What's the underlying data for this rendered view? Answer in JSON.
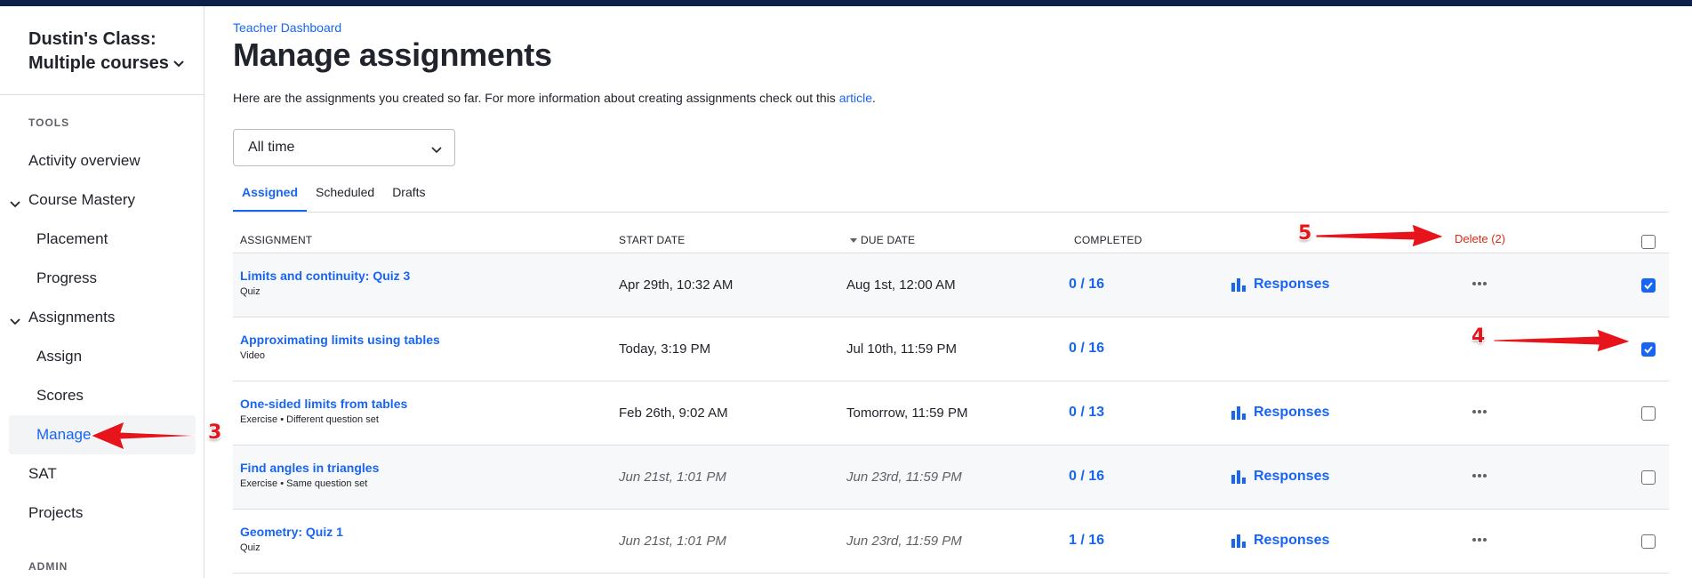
{
  "colors": {
    "accent": "#1865f2",
    "danger": "#d92916",
    "annotation": "#e8141b",
    "topbar": "#0b2149"
  },
  "sidebar": {
    "class_name": "Dustin's Class: Multiple courses",
    "class_line1": "Dustin's Class:",
    "class_line2": "Multiple courses",
    "tools_label": "TOOLS",
    "admin_label": "ADMIN",
    "items": [
      {
        "label": "Activity overview"
      },
      {
        "label": "Course Mastery",
        "expanded": true
      },
      {
        "label": "Placement"
      },
      {
        "label": "Progress"
      },
      {
        "label": "Assignments",
        "expanded": true
      },
      {
        "label": "Assign"
      },
      {
        "label": "Scores"
      },
      {
        "label": "Manage",
        "active": true
      },
      {
        "label": "SAT"
      },
      {
        "label": "Projects"
      }
    ]
  },
  "header": {
    "breadcrumb": "Teacher Dashboard",
    "title": "Manage assignments",
    "intro_text": "Here are the assignments you created so far. For more information about creating assignments check out this",
    "intro_link": "article",
    "intro_end": "."
  },
  "filter": {
    "selected": "All time"
  },
  "tabs": [
    {
      "label": "Assigned",
      "active": true
    },
    {
      "label": "Scheduled"
    },
    {
      "label": "Drafts"
    }
  ],
  "table": {
    "columns": {
      "assignment": "ASSIGNMENT",
      "start_date": "START DATE",
      "due_date": "DUE DATE",
      "completed": "COMPLETED"
    },
    "delete_label": "Delete (2)",
    "responses_label": "Responses",
    "rows": [
      {
        "title": "Limits and continuity: Quiz 3",
        "subtitle": "Quiz",
        "start": "Apr 29th, 10:32 AM",
        "due": "Aug 1st, 12:00 AM",
        "completed": "0 / 16",
        "has_responses": true,
        "checked": true
      },
      {
        "title": "Approximating limits using tables",
        "subtitle": "Video",
        "start": "Today, 3:19 PM",
        "due": "Jul 10th, 11:59 PM",
        "completed": "0 / 16",
        "has_responses": false,
        "checked": true
      },
      {
        "title": "One-sided limits from tables",
        "subtitle": "Exercise • Different question set",
        "start": "Feb 26th, 9:02 AM",
        "due": "Tomorrow, 11:59 PM",
        "completed": "0 / 13",
        "has_responses": true,
        "checked": false
      },
      {
        "title": "Find angles in triangles",
        "subtitle": "Exercise • Same question set",
        "start": "Jun 21st, 1:01 PM",
        "due": "Jun 23rd, 11:59 PM",
        "completed": "0 / 16",
        "has_responses": true,
        "checked": false
      },
      {
        "title": "Geometry: Quiz 1",
        "subtitle": "Quiz",
        "start": "Jun 21st, 1:01 PM",
        "due": "Jun 23rd, 11:59 PM",
        "completed": "1 / 16",
        "has_responses": true,
        "checked": false
      }
    ]
  },
  "annotations": {
    "a3": "3",
    "a4": "4",
    "a5": "5"
  }
}
